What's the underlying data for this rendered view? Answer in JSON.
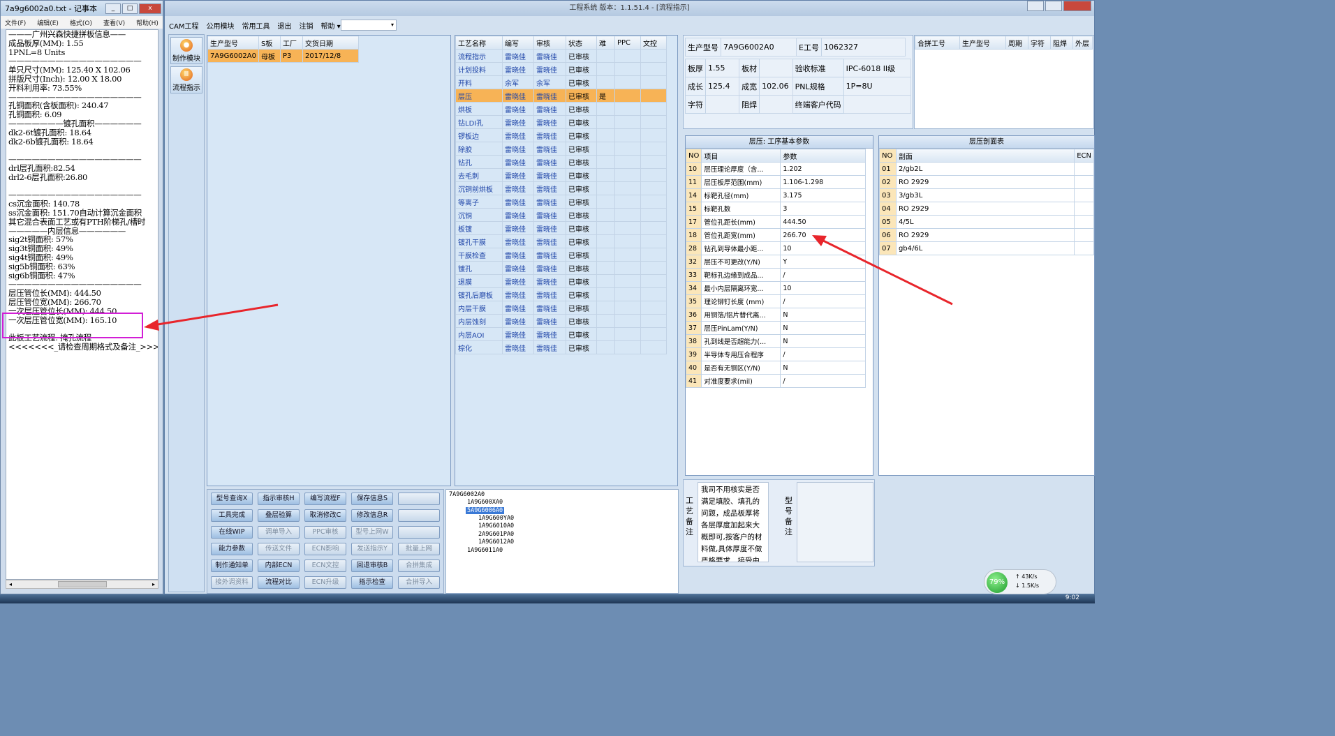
{
  "notepad": {
    "title": "7a9g6002a0.txt - 记事本",
    "menu": [
      "文件(F)",
      "编辑(E)",
      "格式(O)",
      "查看(V)",
      "帮助(H)"
    ],
    "lines": [
      "———广州兴森快捷拼板信息——",
      "成品板厚(MM): 1.55",
      "1PNL=8 Units",
      "—————————————————",
      "单只尺寸(MM): 125.40 X 102.06",
      "拼版尺寸(Inch): 12.00 X 18.00",
      "开料利用率: 73.55%",
      "—————————————————",
      "孔铜面积(含板面积): 240.47",
      "孔铜面积: 6.09",
      "———————镀孔面积——————",
      "dk2-6t镀孔面积: 18.64",
      "dk2-6b镀孔面积: 18.64",
      "",
      "—————————————————",
      "drl层孔面积:82.54",
      "drl2-6层孔面积:26.80",
      "",
      "—————————————————",
      "cs沉金面积: 140.78",
      "ss沉金面积: 151.70自动计算沉金面积",
      "其它混合表面工艺或有PTH阶梯孔/槽时",
      "—————内层信息——————",
      "sig2t铜面积: 57%",
      "sig3t铜面积: 49%",
      "sig4t铜面积: 49%",
      "sig5b铜面积: 63%",
      "sig6b铜面积: 47%",
      "—————————————————",
      "层压管位长(MM): 444.50",
      "层压管位宽(MM): 266.70",
      "一次层压管位长(MM): 444.50",
      "一次层压管位宽(MM): 165.10",
      "",
      "此板工艺流程: 掩孔流程",
      "<<<<<<<_请检查周期格式及备注_>>>>>"
    ]
  },
  "app": {
    "title": "工程系统  版本：1.1.51.4 - [流程指示]",
    "menu": [
      "CAM工程",
      "公用模块",
      "常用工具",
      "退出",
      "注销",
      "帮助 ▾"
    ],
    "sidebar": [
      "制作模块",
      "流程指示"
    ],
    "product_grid": {
      "headers": [
        "生产型号",
        "S板",
        "工厂",
        "交货日期"
      ],
      "rows": [
        [
          "7A9G6002A0",
          "母板",
          "P3",
          "2017/12/8"
        ]
      ]
    },
    "process_grid": {
      "headers": [
        "工艺名称",
        "编写",
        "审核",
        "状态",
        "难",
        "PPC",
        "文控"
      ],
      "rows": [
        [
          "流程指示",
          "雷晓佳",
          "雷晓佳",
          "已审核",
          "",
          "",
          ""
        ],
        [
          "计划投料",
          "雷晓佳",
          "雷晓佳",
          "已审核",
          "",
          "",
          ""
        ],
        [
          "开料",
          "余军",
          "余军",
          "已审核",
          "",
          "",
          ""
        ],
        [
          "层压",
          "雷晓佳",
          "雷晓佳",
          "已审核",
          "是",
          "",
          ""
        ],
        [
          "烘板",
          "雷晓佳",
          "雷晓佳",
          "已审核",
          "",
          "",
          ""
        ],
        [
          "钻LDI孔",
          "雷晓佳",
          "雷晓佳",
          "已审核",
          "",
          "",
          ""
        ],
        [
          "锣板边",
          "雷晓佳",
          "雷晓佳",
          "已审核",
          "",
          "",
          ""
        ],
        [
          "除胶",
          "雷晓佳",
          "雷晓佳",
          "已审核",
          "",
          "",
          ""
        ],
        [
          "钻孔",
          "雷晓佳",
          "雷晓佳",
          "已审核",
          "",
          "",
          ""
        ],
        [
          "去毛刺",
          "雷晓佳",
          "雷晓佳",
          "已审核",
          "",
          "",
          ""
        ],
        [
          "沉铜前烘板",
          "雷晓佳",
          "雷晓佳",
          "已审核",
          "",
          "",
          ""
        ],
        [
          "等离子",
          "雷晓佳",
          "雷晓佳",
          "已审核",
          "",
          "",
          ""
        ],
        [
          "沉铜",
          "雷晓佳",
          "雷晓佳",
          "已审核",
          "",
          "",
          ""
        ],
        [
          "板镀",
          "雷晓佳",
          "雷晓佳",
          "已审核",
          "",
          "",
          ""
        ],
        [
          "镀孔干膜",
          "雷晓佳",
          "雷晓佳",
          "已审核",
          "",
          "",
          ""
        ],
        [
          "干膜检查",
          "雷晓佳",
          "雷晓佳",
          "已审核",
          "",
          "",
          ""
        ],
        [
          "镀孔",
          "雷晓佳",
          "雷晓佳",
          "已审核",
          "",
          "",
          ""
        ],
        [
          "退膜",
          "雷晓佳",
          "雷晓佳",
          "已审核",
          "",
          "",
          ""
        ],
        [
          "镀孔后磨板",
          "雷晓佳",
          "雷晓佳",
          "已审核",
          "",
          "",
          ""
        ],
        [
          "内层干膜",
          "雷晓佳",
          "雷晓佳",
          "已审核",
          "",
          "",
          ""
        ],
        [
          "内层蚀刻",
          "雷晓佳",
          "雷晓佳",
          "已审核",
          "",
          "",
          ""
        ],
        [
          "内层AOI",
          "雷晓佳",
          "雷晓佳",
          "已审核",
          "",
          "",
          ""
        ],
        [
          "棕化",
          "雷晓佳",
          "雷晓佳",
          "已审核",
          "",
          "",
          ""
        ]
      ]
    },
    "info": {
      "prod_no_label": "生产型号",
      "prod_no": "7A9G6002A0",
      "eng_no_label": "E工号",
      "eng_no": "1062327",
      "thick_label": "板厚",
      "thick": "1.55",
      "mat_label": "板材",
      "mat": "",
      "std_label": "验收标准",
      "std": "IPC-6018 II级",
      "len_label": "成长",
      "len": "125.4",
      "wid_label": "成宽",
      "wid": "102.06",
      "pnl_label": "PNL规格",
      "pnl": "1P=8U",
      "char_label": "字符",
      "char": "",
      "mask_label": "阻焊",
      "mask": "",
      "cust_label": "终端客户代码",
      "cust": ""
    },
    "merge_grid": {
      "headers": [
        "合拼工号",
        "生产型号",
        "周期",
        "字符",
        "阻焊",
        "外层"
      ]
    },
    "param_panel": {
      "title": "层压: 工序基本参数",
      "headers": [
        "NO",
        "项目",
        "参数"
      ],
      "rows": [
        [
          "10",
          "层压理论厚度（含...",
          "1.202"
        ],
        [
          "11",
          "层压板厚范围(mm)",
          "1.106-1.298"
        ],
        [
          "14",
          "标靶孔径(mm)",
          "3.175"
        ],
        [
          "15",
          "标靶孔数",
          "3"
        ],
        [
          "17",
          "管位孔距长(mm)",
          "444.50"
        ],
        [
          "18",
          "管位孔距宽(mm)",
          "266.70"
        ],
        [
          "28",
          "钻孔到导体最小距...",
          "10"
        ],
        [
          "32",
          "层压不可更改(Y/N)",
          "Y"
        ],
        [
          "33",
          "靶标孔边缘到成品...",
          "/"
        ],
        [
          "34",
          "最小内层隔离环宽...",
          "10"
        ],
        [
          "35",
          "理论铆钉长度 (mm)",
          "/"
        ],
        [
          "36",
          "用铜箔/铝片替代离...",
          "N"
        ],
        [
          "37",
          "层压PinLam(Y/N)",
          "N"
        ],
        [
          "38",
          "孔到线是否超能力(...",
          "N"
        ],
        [
          "39",
          "半导体专用压合程序",
          "/"
        ],
        [
          "40",
          "是否有无铜区(Y/N)",
          "N"
        ],
        [
          "41",
          "对准度要求(mil)",
          "/"
        ]
      ]
    },
    "layer_panel": {
      "title": "层压剖面表",
      "headers": [
        "NO",
        "剖面",
        "ECN"
      ],
      "rows": [
        [
          "01",
          "2/gb2L"
        ],
        [
          "02",
          "RO 2929"
        ],
        [
          "03",
          "3/gb3L"
        ],
        [
          "04",
          "RO 2929"
        ],
        [
          "05",
          "4/5L"
        ],
        [
          "06",
          "RO 2929"
        ],
        [
          "07",
          "gb4/6L"
        ]
      ]
    },
    "buttons": [
      [
        "型号查询X",
        "指示审核H",
        "编写流程F",
        "保存信息S",
        ""
      ],
      [
        "工具完成",
        "叠层验算",
        "取消修改C",
        "修改信息R",
        ""
      ],
      [
        "在线WIP",
        "调单导入",
        "PPC审核",
        "型号上网W",
        ""
      ],
      [
        "能力参数",
        "传送文件",
        "ECN影响",
        "发送指示Y",
        "批量上网"
      ],
      [
        "制作通知单",
        "内部ECN",
        "ECN文控",
        "回退审核B",
        "合拼集成"
      ],
      [
        "接外调资料",
        "流程对比",
        "ECN升级",
        "指示检查",
        "合拼导入"
      ]
    ],
    "tree": [
      "7A9G6002A0",
      "1A9G600XA0",
      "5A9G6006A0",
      "1A9G600YA0",
      "1A9G6010A0",
      "2A9G601PA0",
      "1A9G6012A0",
      "1A9G6011A0"
    ],
    "notes": {
      "label": "工艺备注",
      "text": "我司不用核实是否满足填胶、填孔的问题，成品板厚将各层厚度加起来大概即可,按客户的材料做,具体厚度不做严格要求。接受由",
      "label2": "型号备注"
    },
    "net": {
      "pct": "79%",
      "up": "43K/s",
      "down": "1.5K/s"
    }
  },
  "taskbar": {
    "clock": "9:02"
  },
  "colors": {
    "highlight_box": "#d21ed6",
    "arrow": "#e8252b",
    "selected_row": "#f7b356"
  }
}
